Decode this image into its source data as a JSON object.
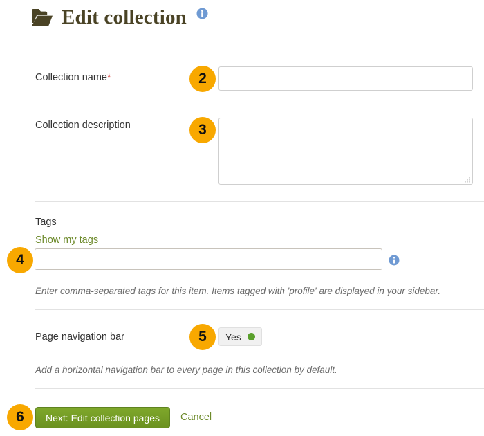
{
  "header": {
    "title": "Edit collection",
    "folder_icon": "folder-open-icon",
    "info_icon": "info-icon"
  },
  "fields": {
    "collection_name": {
      "label": "Collection name",
      "required_mark": "*",
      "value": "",
      "placeholder": "",
      "badge": "2"
    },
    "collection_description": {
      "label": "Collection description",
      "value": "",
      "placeholder": "",
      "badge": "3"
    },
    "tags": {
      "label": "Tags",
      "show_my_tags_link": "Show my tags",
      "value": "",
      "placeholder": "",
      "badge": "4",
      "info_icon": "info-icon",
      "help_text": "Enter comma-separated tags for this item. Items tagged with 'profile' are displayed in your sidebar."
    },
    "page_navigation_bar": {
      "label": "Page navigation bar",
      "toggle_value": "Yes",
      "badge": "5",
      "help_text": "Add a horizontal navigation bar to every page in this collection by default."
    }
  },
  "footer": {
    "primary_button": "Next: Edit collection pages",
    "cancel_link": "Cancel",
    "badge": "6"
  },
  "colors": {
    "badge_orange": "#f8a800",
    "title_olive": "#4a4325",
    "link_green": "#6d8a2b",
    "button_green": "#6b9120",
    "toggle_dot_green": "#5aa02c",
    "required_red": "#d9534f",
    "info_blue": "#6f9ad3"
  }
}
